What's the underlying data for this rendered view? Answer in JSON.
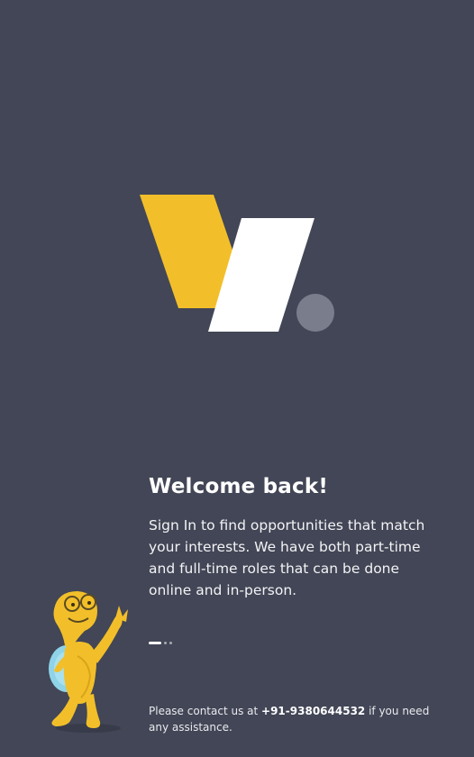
{
  "brand": {
    "colors": {
      "background": "#424656",
      "logo_yellow": "#F2BF2A",
      "logo_white": "#FFFFFF",
      "logo_dot": "#7A7E8C"
    }
  },
  "welcome": {
    "title": "Welcome back!",
    "description": "Sign In to find opportunities that match your interests. We have both part-time and full-time roles that can be done online and in-person."
  },
  "carousel": {
    "total_slides": 3,
    "active_index": 0
  },
  "footer": {
    "prefix": "Please contact us at ",
    "phone": "+91-9380644532",
    "suffix": " if you need any assistance."
  },
  "icons": {
    "logo": "brand-logo-icon",
    "mascot": "turtle-mascot-icon"
  }
}
